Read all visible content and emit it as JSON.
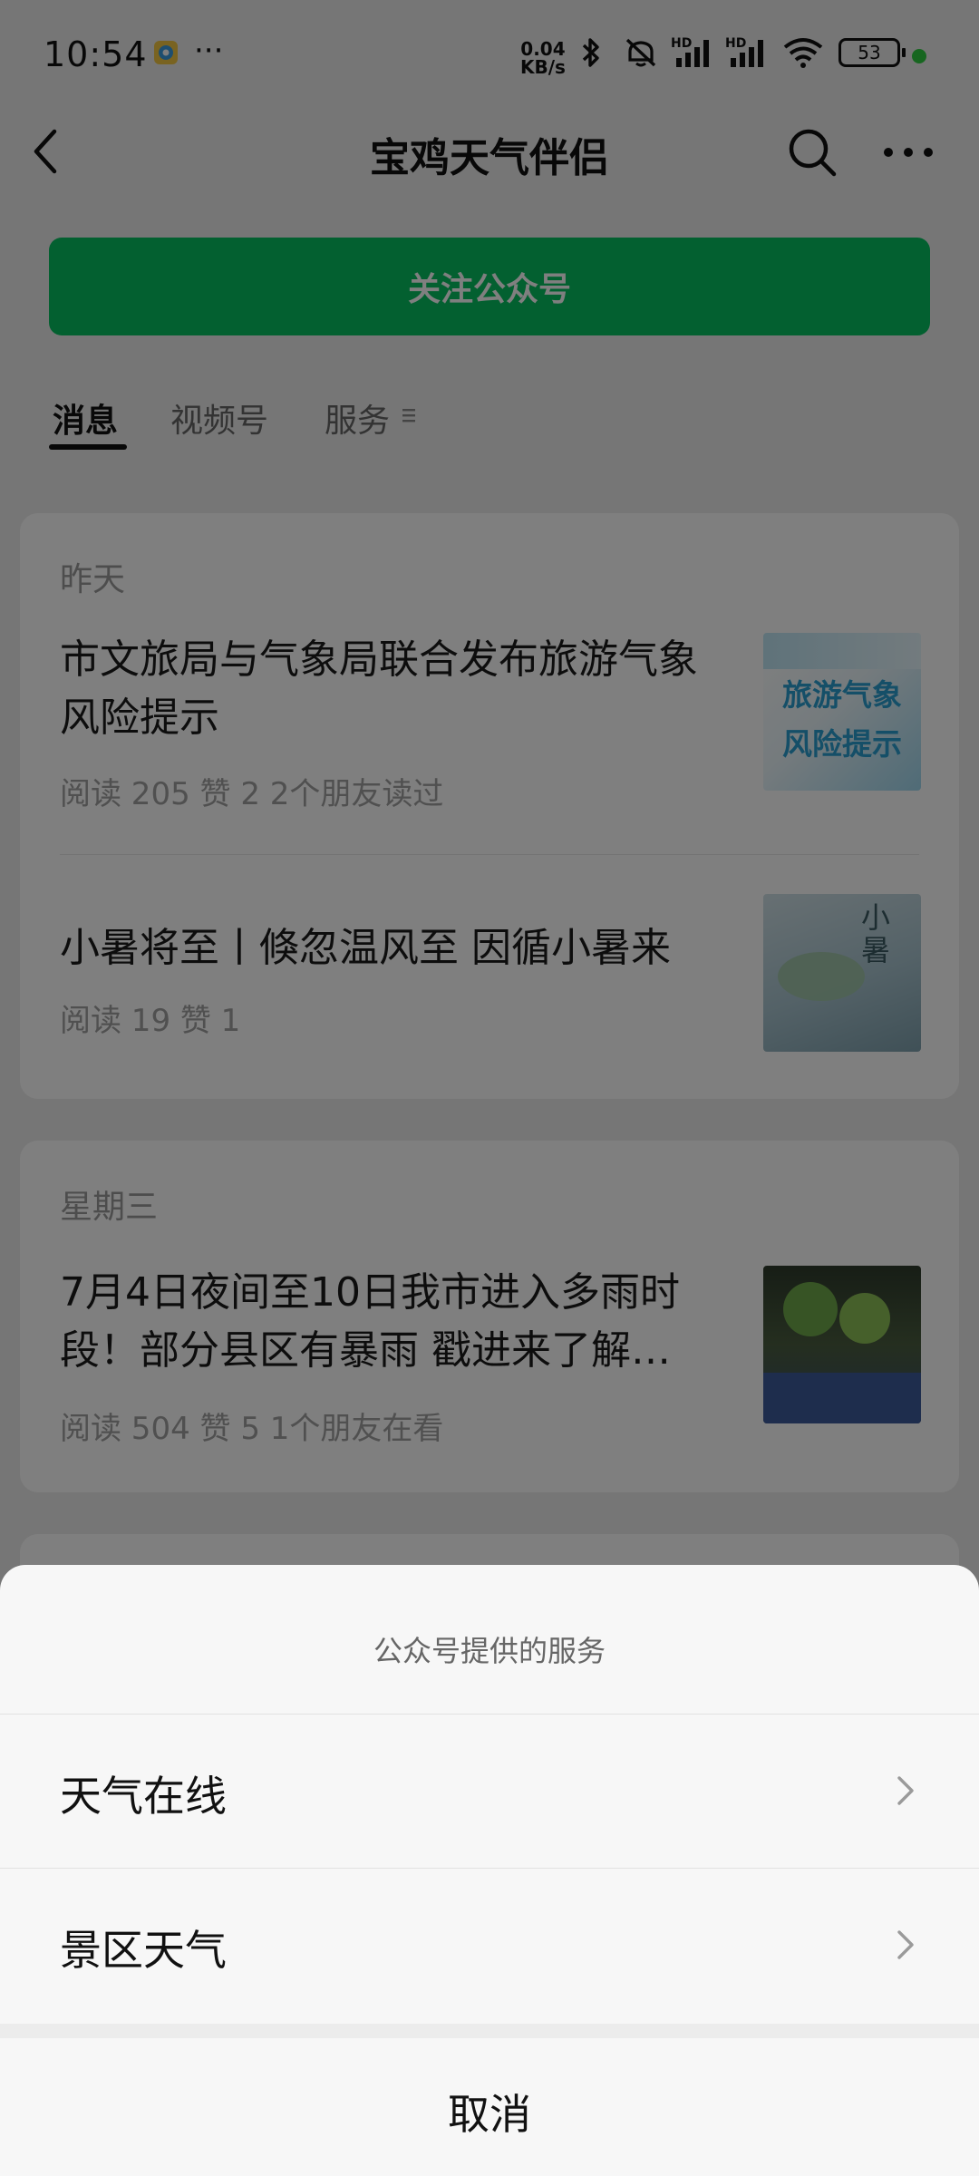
{
  "status_bar": {
    "time": "10:54",
    "more_dots": "···",
    "net_speed_value": "0.04",
    "net_speed_unit": "KB/s",
    "hd1": "HD",
    "hd2": "HD",
    "battery": "53",
    "icons": [
      "app-notification-icon",
      "bluetooth-icon",
      "mute-icon",
      "signal-icon",
      "signal-icon",
      "wifi-icon",
      "battery-icon",
      "camera-dot-icon"
    ]
  },
  "header": {
    "title": "宝鸡天气伴侣",
    "back_icon": "chevron-left-icon",
    "search_icon": "search-icon",
    "more_icon": "more-icon"
  },
  "follow_button": {
    "label": "关注公众号",
    "color": "#07c160"
  },
  "tabs": [
    {
      "label": "消息",
      "active": true
    },
    {
      "label": "视频号",
      "active": false
    },
    {
      "label": "服务",
      "active": false
    }
  ],
  "feed": [
    {
      "date": "昨天",
      "articles": [
        {
          "title_line1": "市文旅局与气象局联合发布旅游气象",
          "title_line2": "风险提示",
          "meta": "阅读 205   赞 2   2个朋友读过",
          "thumb_line1": "旅游气象",
          "thumb_line2": "风险提示"
        },
        {
          "title_line1": "小暑将至丨倏忽温风至 因循小暑来",
          "meta": "阅读 19   赞 1",
          "thumb_line1": "小暑"
        }
      ]
    },
    {
      "date": "星期三",
      "articles": [
        {
          "title_line1": "7月4日夜间至10日我市进入多雨时",
          "title_line2": "段！部分县区有暴雨 戳进来了解…",
          "meta": "阅读 504   赞 5   1个朋友在看"
        }
      ]
    }
  ],
  "sheet": {
    "title": "公众号提供的服务",
    "items": [
      {
        "label": "天气在线",
        "icon": "chevron-right-icon"
      },
      {
        "label": "景区天气",
        "icon": "chevron-right-icon"
      }
    ],
    "cancel": "取消"
  }
}
